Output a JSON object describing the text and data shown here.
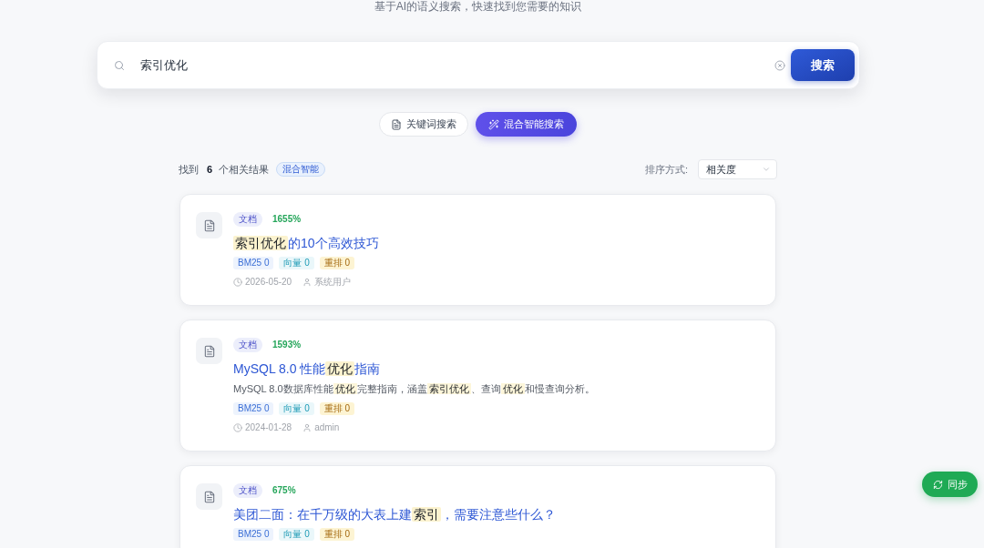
{
  "header": {
    "subtitle": "基于AI的语义搜索，快速找到您需要的知识"
  },
  "search": {
    "value": "索引优化",
    "button": "搜索"
  },
  "modes": [
    {
      "label": "关键词搜索",
      "kind": "keyword",
      "selected": false
    },
    {
      "label": "混合智能搜索",
      "kind": "hybrid",
      "selected": true
    }
  ],
  "summary": {
    "prefix": "找到",
    "count": "6",
    "suffix": "个相关结果",
    "badge": "混合智能"
  },
  "sort": {
    "label": "排序方式:",
    "value": "相关度"
  },
  "results": [
    {
      "type": "文档",
      "score": "1655%",
      "title": [
        {
          "text": "索引优化",
          "highlight": true
        },
        {
          "text": "的10个高效技巧",
          "highlight": false
        }
      ],
      "scores": [
        {
          "kind": "bm25",
          "label": "BM25 0"
        },
        {
          "kind": "vector",
          "label": "向量 0"
        },
        {
          "kind": "rerank",
          "label": "重排 0"
        }
      ],
      "date": "2026-05-20",
      "author": "系统用户"
    },
    {
      "type": "文档",
      "score": "1593%",
      "title": [
        {
          "text": "MySQL 8.0 性能",
          "highlight": false
        },
        {
          "text": "优化",
          "highlight": true
        },
        {
          "text": "指南",
          "highlight": false
        }
      ],
      "description": [
        {
          "text": "MySQL 8.0数据库性能",
          "highlight": false
        },
        {
          "text": "优化",
          "highlight": true
        },
        {
          "text": "完整指南，涵盖",
          "highlight": false
        },
        {
          "text": "索引优化",
          "highlight": true
        },
        {
          "text": "、查询",
          "highlight": false
        },
        {
          "text": "优化",
          "highlight": true
        },
        {
          "text": "和慢查询分析。",
          "highlight": false
        }
      ],
      "scores": [
        {
          "kind": "bm25",
          "label": "BM25 0"
        },
        {
          "kind": "vector",
          "label": "向量 0"
        },
        {
          "kind": "rerank",
          "label": "重排 0"
        }
      ],
      "date": "2024-01-28",
      "author": "admin"
    },
    {
      "type": "文档",
      "score": "675%",
      "title": [
        {
          "text": "美团二面：在千万级的大表上建",
          "highlight": false
        },
        {
          "text": "索引",
          "highlight": true
        },
        {
          "text": "，需要注意些什么？",
          "highlight": false
        }
      ],
      "scores": [
        {
          "kind": "bm25",
          "label": "BM25 0"
        },
        {
          "kind": "vector",
          "label": "向量 0"
        },
        {
          "kind": "rerank",
          "label": "重排 0"
        }
      ]
    }
  ],
  "sync_button": {
    "label": "同步"
  }
}
